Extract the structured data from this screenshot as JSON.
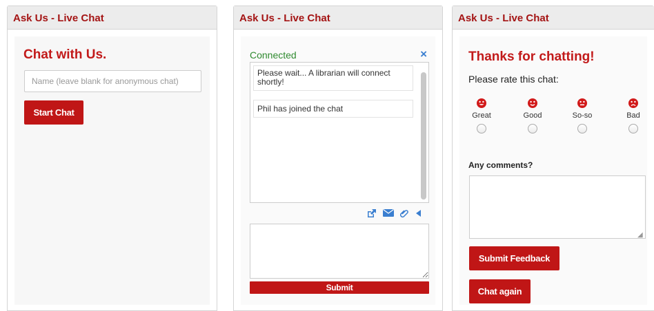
{
  "panels": [
    {
      "header": "Ask Us - Live Chat",
      "title": "Chat with Us.",
      "name_input": {
        "placeholder": "Name (leave blank for anonymous chat)",
        "value": ""
      },
      "start_button": "Start Chat"
    },
    {
      "header": "Ask Us - Live Chat",
      "status": "Connected",
      "close_glyph": "×",
      "messages": [
        "Please wait... A librarian will connect shortly!",
        "Phil has joined the chat"
      ],
      "tools": [
        "external-link-icon",
        "email-icon",
        "paperclip-icon",
        "collapse-arrow-icon"
      ],
      "submit_button": "Submit"
    },
    {
      "header": "Ask Us - Live Chat",
      "title": "Thanks for chatting!",
      "rate_prompt": "Please rate this chat:",
      "ratings": [
        {
          "label": "Great",
          "icon": "smile-icon"
        },
        {
          "label": "Good",
          "icon": "smile-icon"
        },
        {
          "label": "So-so",
          "icon": "neutral-face-icon"
        },
        {
          "label": "Bad",
          "icon": "frown-icon"
        }
      ],
      "comments_label": "Any comments?",
      "submit_feedback_button": "Submit Feedback",
      "chat_again_button": "Chat again"
    }
  ],
  "colors": {
    "brand_red": "#c01616",
    "header_text": "#a41414",
    "connected_green": "#2f8a2f",
    "icon_blue": "#3b7fd0"
  }
}
